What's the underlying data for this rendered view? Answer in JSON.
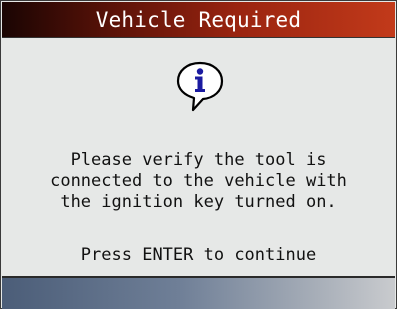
{
  "header": {
    "title": "Vehicle Required"
  },
  "dialog": {
    "icon": "info-icon",
    "icon_glyph": "i",
    "message_lines": [
      "Please verify the tool is",
      "connected to the vehicle with",
      "the ignition key turned on."
    ],
    "prompt": "Press ENTER to continue"
  },
  "colors": {
    "title_bar_start": "#1a0503",
    "title_bar_end": "#c23a1a",
    "content_bg": "#e6e8e7",
    "icon_accent": "#1a1aa0",
    "bottom_bar_start": "#4b5d78",
    "bottom_bar_end": "#c9cbce"
  }
}
